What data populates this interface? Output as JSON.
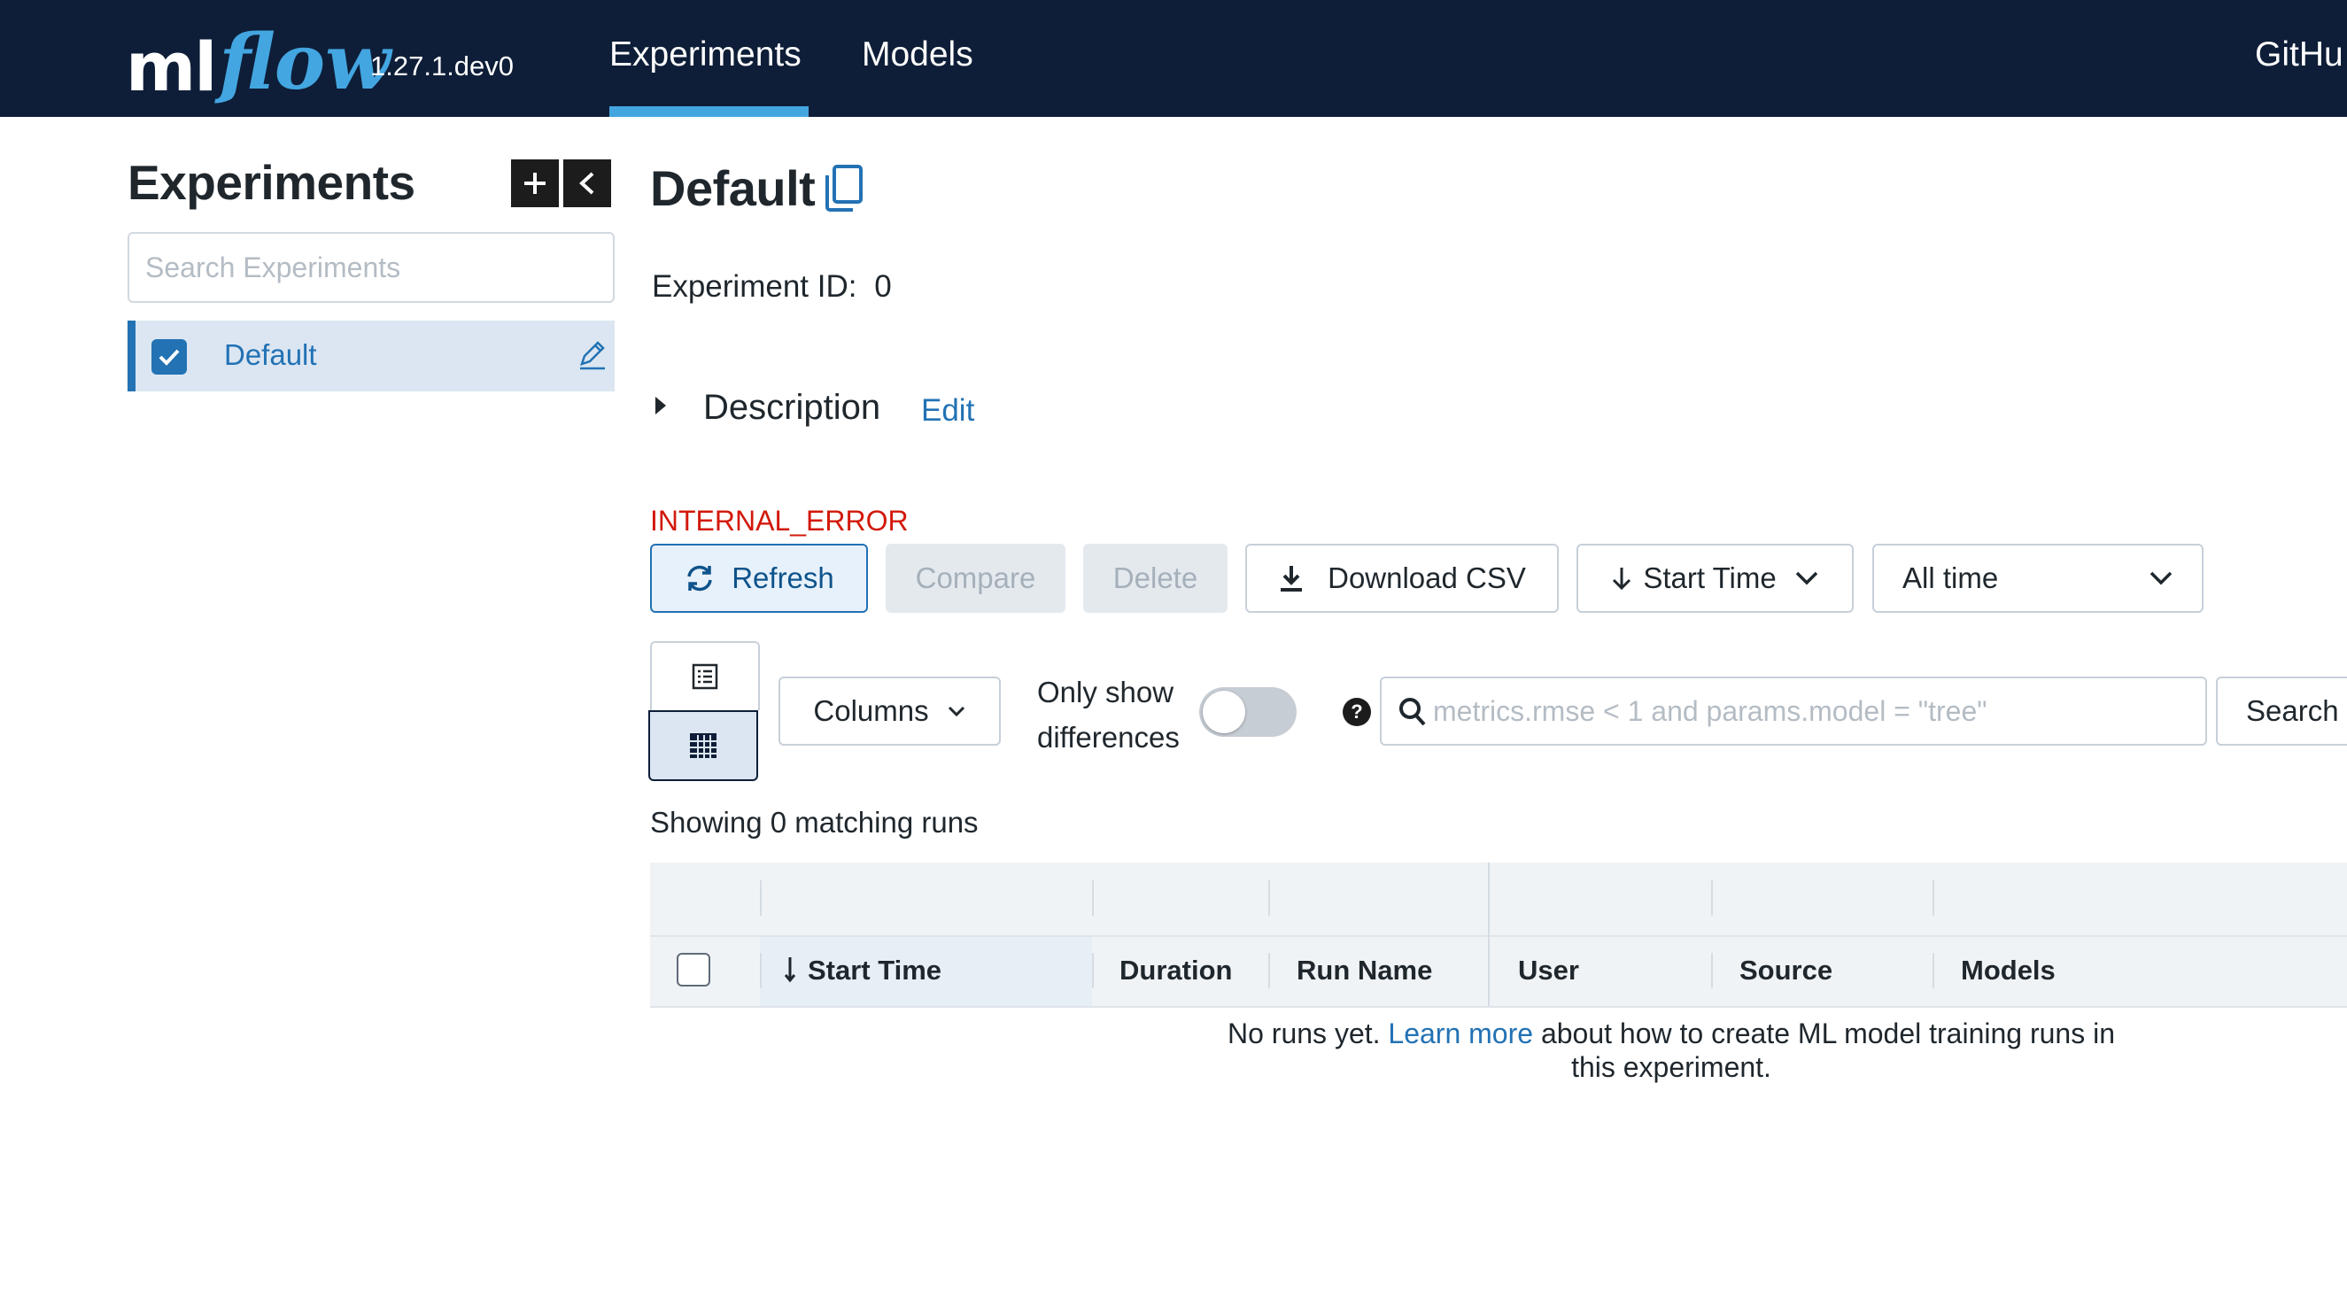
{
  "header": {
    "logo_ml": "ml",
    "logo_flow": "flow",
    "version": "1.27.1.dev0",
    "nav": [
      {
        "label": "Experiments",
        "active": true
      },
      {
        "label": "Models",
        "active": false
      }
    ],
    "github": "GitHu",
    "accent": "#43a6e1",
    "background": "#0e1e38"
  },
  "sidebar": {
    "title": "Experiments",
    "add_icon": "plus-icon",
    "collapse_icon": "chevron-left-icon",
    "search_placeholder": "Search Experiments",
    "items": [
      {
        "label": "Default",
        "checked": true
      }
    ]
  },
  "experiment": {
    "title": "Default",
    "id_label": "Experiment ID:",
    "id_value": "0",
    "description_label": "Description",
    "description_edit": "Edit",
    "error": "INTERNAL_ERROR"
  },
  "toolbar": {
    "refresh": "Refresh",
    "compare": "Compare",
    "delete": "Delete",
    "download_csv": "Download CSV",
    "sort_by": "Start Time",
    "time_range": "All time",
    "columns": "Columns",
    "only_show_line1": "Only show",
    "only_show_line2": "differences",
    "only_show_on": false,
    "search_placeholder": "metrics.rmse < 1 and params.model = \"tree\"",
    "search_button": "Search"
  },
  "runs": {
    "showing": "Showing 0 matching runs",
    "columns": [
      "Start Time",
      "Duration",
      "Run Name",
      "User",
      "Source",
      "Models"
    ],
    "empty_prefix": "No runs yet. ",
    "empty_link": "Learn more",
    "empty_suffix": " about how to create ML model training runs in this experiment."
  }
}
